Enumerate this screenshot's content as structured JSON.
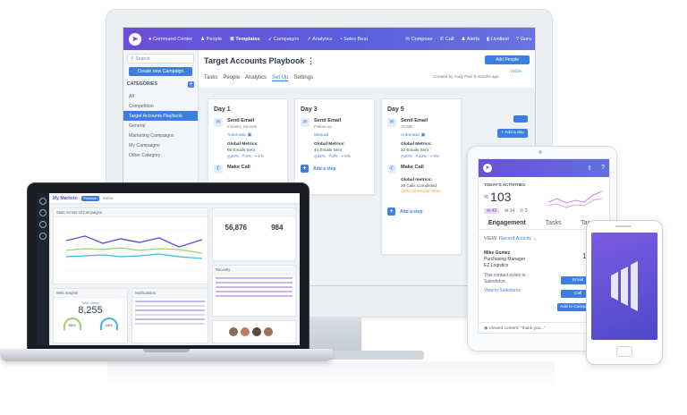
{
  "monitor": {
    "nav": {
      "brand_icon": "marketo-logo-icon",
      "items": [
        "Command Center",
        "People",
        "Templates",
        "Campaigns",
        "Analytics",
        "Sales Beat"
      ],
      "right_items": [
        "Compose",
        "Call",
        "Alerts",
        "Liveliest",
        "Guru"
      ]
    },
    "sidebar": {
      "search_placeholder": "Search",
      "create_button": "Create new Campaign",
      "categories_title": "CATEGORIES",
      "categories": [
        "All",
        "Competition",
        "Target Accounts Playbook",
        "General",
        "Marketing Campaigns",
        "My Campaigns",
        "Other Category"
      ],
      "active_index": 2
    },
    "main": {
      "title": "Target Accounts Playbook",
      "add_people": "Add People",
      "visibility": "Visible",
      "created_by": "Created by Andy Paul 6 months ago",
      "tabs": [
        "Tasks",
        "People",
        "Analytics",
        "Set Up",
        "Settings"
      ],
      "active_tab": 3,
      "add_day": "+ Add a day",
      "days": [
        {
          "title": "Day 1",
          "steps": [
            {
              "icon": "email-icon",
              "title": "Send Email",
              "sub": "Industry Secrets"
            }
          ],
          "mode": "Automatic",
          "metrics_title": "Global Metrics:",
          "metric_line": "65 Emails Sent",
          "stats": [
            "30%",
            "4%",
            "1%"
          ],
          "next_step": {
            "icon": "phone-icon",
            "title": "Make Call"
          }
        },
        {
          "title": "Day 3",
          "steps": [
            {
              "icon": "email-icon",
              "title": "Send Email",
              "sub": "Follow-up"
            }
          ],
          "mode": "Manual",
          "metrics_title": "Global Metrics:",
          "metric_line": "44 Emails Sent",
          "stats": [
            "34%",
            "8%",
            "3%"
          ],
          "add_step": "Add a step"
        },
        {
          "title": "Day 5",
          "steps": [
            {
              "icon": "email-icon",
              "title": "Send Email",
              "sub": "ACME"
            }
          ],
          "mode": "Automatic",
          "metrics_title": "Global Metrics:",
          "metric_line": "32 Emails Sent",
          "stats": [
            "40%",
            "12%",
            "4%"
          ],
          "call": {
            "title": "Make Call",
            "metrics_title": "Global metrics:",
            "line1": "29 Calls Completed",
            "line2": "15% Connection Rate"
          },
          "add_step": "Add a step"
        }
      ]
    }
  },
  "laptop": {
    "header": {
      "brand": "My Marketo",
      "badge": "Personal",
      "tab": "Sales"
    },
    "chart": {
      "title": "Stats Across all Campaigns"
    },
    "stats": {
      "val1": "56,876",
      "val2": "984"
    },
    "web_insights": {
      "title": "Web Insights",
      "views_label": "Total Views",
      "views": "8,255",
      "g1": "56%",
      "g2": "44%"
    },
    "notifications": {
      "title": "Notifications"
    },
    "recently": {
      "title": "Recently"
    }
  },
  "tablet": {
    "section": "TODAY'S ACTIVITIES",
    "count": "103",
    "badges": [
      "14",
      "2"
    ],
    "tabs": [
      "Engagement",
      "Tasks",
      "Targets"
    ],
    "view_label": "VIEW:",
    "view_value": "Recent Activity",
    "contact": {
      "name": "Mike Gomez",
      "title": "Purchasing Manager",
      "company": "EZ Logistics",
      "note": "This contact exists in Salesforce.",
      "link": "View in Salesforce",
      "count": "10"
    },
    "actions": [
      "Email",
      "Call",
      "Add to Campaign"
    ],
    "footer": "Viewed content: \"thank you...\""
  },
  "colors": {
    "accent": "#3d7fe0",
    "brand": "#5c4fd8",
    "success": "#3cb371",
    "warning": "#f0a030"
  }
}
